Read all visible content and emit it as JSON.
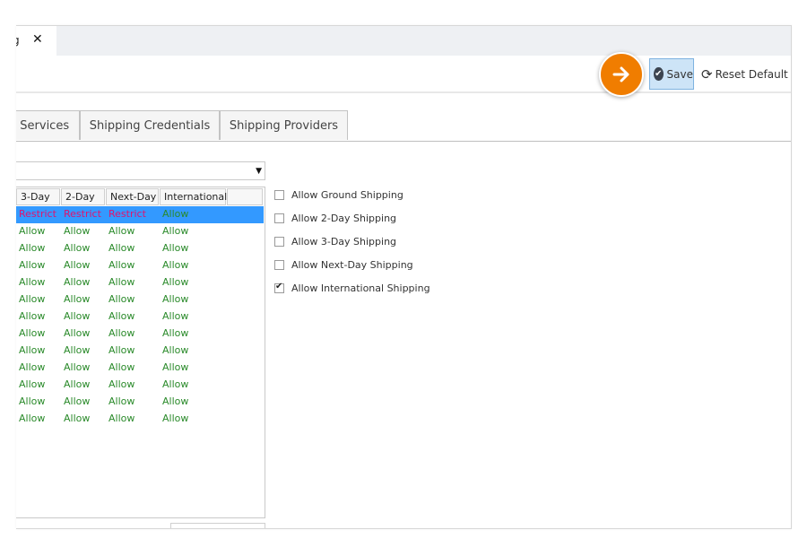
{
  "window": {
    "doc_tab_title": "g",
    "close_glyph": "✕"
  },
  "toolbar": {
    "save_label": "Save",
    "reset_label": "Reset Default"
  },
  "tabs": [
    {
      "label": "g Services"
    },
    {
      "label": "Shipping Credentials"
    },
    {
      "label": "Shipping Providers"
    }
  ],
  "dropdown": {
    "value": ""
  },
  "grid": {
    "columns": [
      "3-Day",
      "2-Day",
      "Next-Day",
      "International"
    ],
    "rows": [
      [
        "Restrict",
        "Restrict",
        "Restrict",
        "Allow"
      ],
      [
        "Allow",
        "Allow",
        "Allow",
        "Allow"
      ],
      [
        "Allow",
        "Allow",
        "Allow",
        "Allow"
      ],
      [
        "Allow",
        "Allow",
        "Allow",
        "Allow"
      ],
      [
        "Allow",
        "Allow",
        "Allow",
        "Allow"
      ],
      [
        "Allow",
        "Allow",
        "Allow",
        "Allow"
      ],
      [
        "Allow",
        "Allow",
        "Allow",
        "Allow"
      ],
      [
        "Allow",
        "Allow",
        "Allow",
        "Allow"
      ],
      [
        "Allow",
        "Allow",
        "Allow",
        "Allow"
      ],
      [
        "Allow",
        "Allow",
        "Allow",
        "Allow"
      ],
      [
        "Allow",
        "Allow",
        "Allow",
        "Allow"
      ],
      [
        "Allow",
        "Allow",
        "Allow",
        "Allow"
      ],
      [
        "Allow",
        "Allow",
        "Allow",
        "Allow"
      ]
    ]
  },
  "options": [
    {
      "label": "Allow Ground Shipping",
      "checked": false
    },
    {
      "label": "Allow 2-Day Shipping",
      "checked": false
    },
    {
      "label": "Allow 3-Day Shipping",
      "checked": false
    },
    {
      "label": "Allow Next-Day Shipping",
      "checked": false
    },
    {
      "label": "Allow International Shipping",
      "checked": true
    }
  ],
  "colors": {
    "accent_pointer": "#f07d00",
    "selected_row": "#3399ff",
    "allow_text": "#2a8a2a",
    "restrict_text": "#e0136e"
  },
  "icons": {
    "save": "check-circle-icon",
    "reset": "refresh-icon",
    "pointer": "arrow-right-icon",
    "dropdown": "caret-down-icon"
  }
}
